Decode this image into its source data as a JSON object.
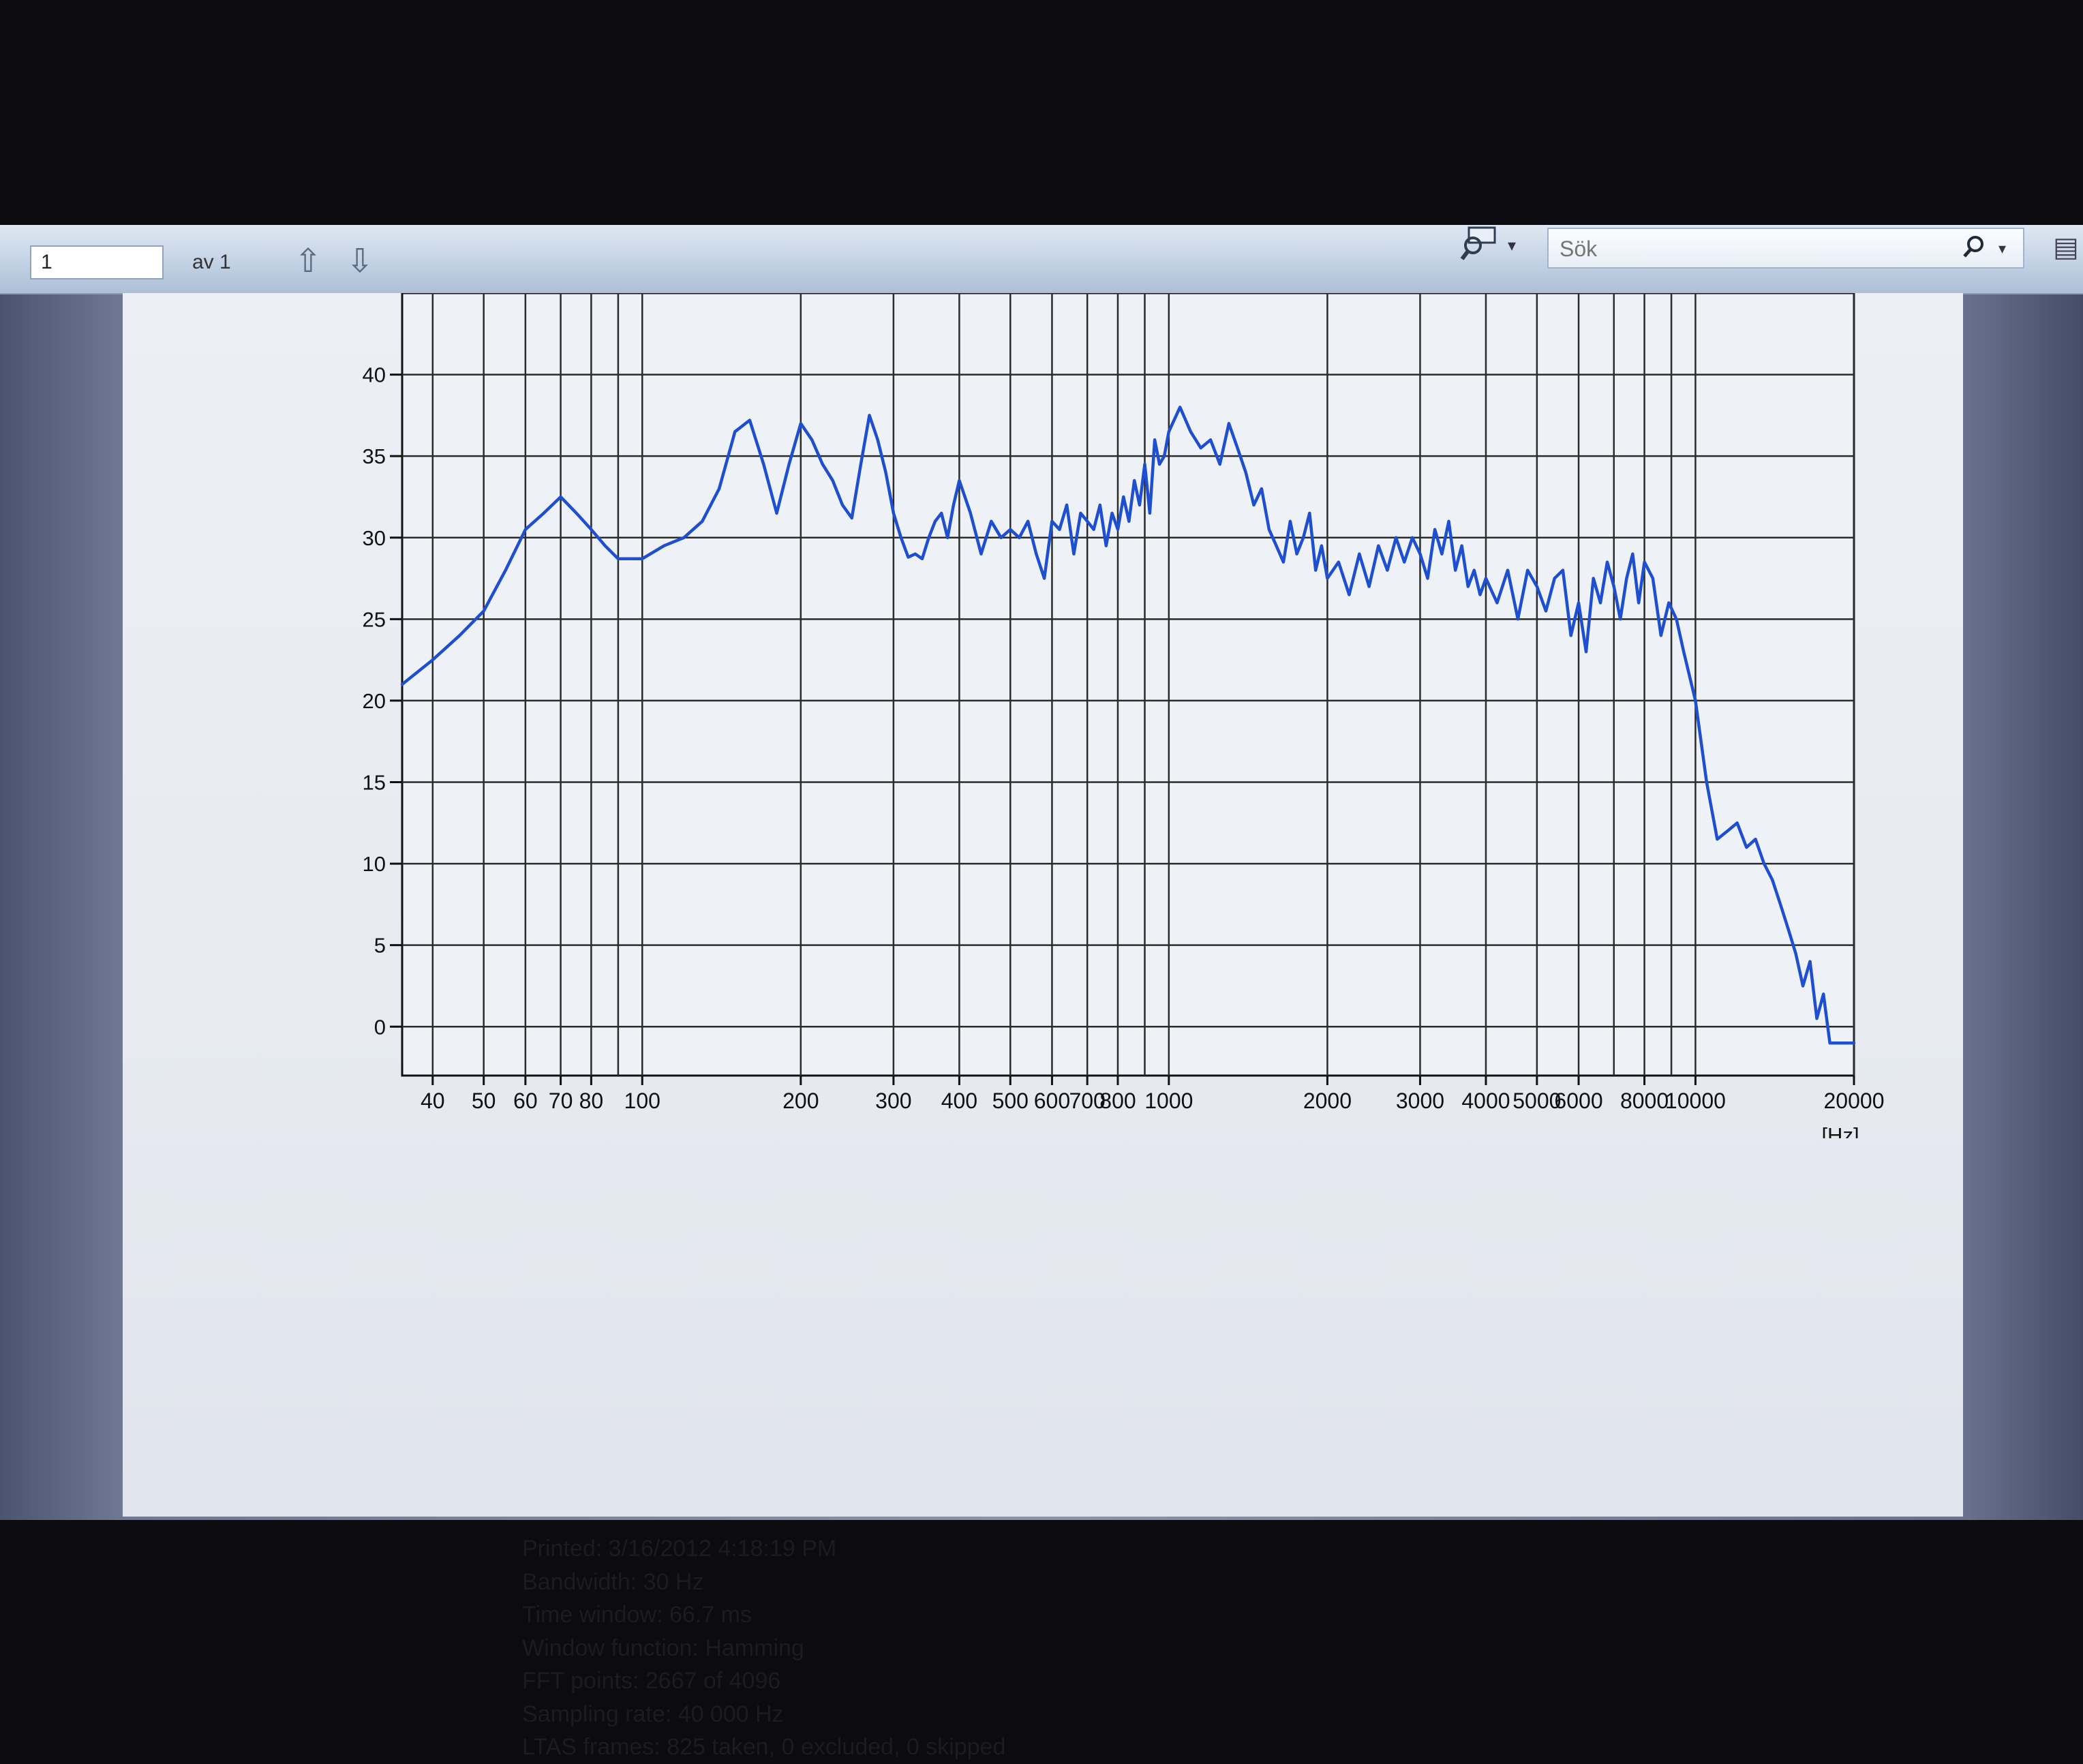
{
  "toolbar": {
    "page_number": "1",
    "page_of": "av 1",
    "up_arrow_glyph": "⇧",
    "down_arrow_glyph": "⇩",
    "search_placeholder": "Sök",
    "search_glyph": "⚲",
    "dropdown_glyph": "▾"
  },
  "info": {
    "printed": "Printed: 3/16/2012 4:18:19 PM",
    "bandwidth": "Bandwidth: 30 Hz",
    "time_window": "Time window: 66.7 ms",
    "window_function": "Window function: Hamming",
    "fft_points": "FFT points: 2667 of 4096",
    "sampling_rate": "Sampling rate: 40 000 Hz",
    "ltas_frames": "LTAS frames: 825 taken, 0 excluded, 0 skipped"
  },
  "chart_data": {
    "type": "line",
    "x_scale": "log",
    "xlim": [
      35,
      20000
    ],
    "ylim": [
      -3,
      45
    ],
    "grid": true,
    "xlabel": "[Hz]",
    "ylabel": "",
    "x_tick_labels": [
      "40",
      "50",
      "60",
      "70",
      "80",
      "100",
      "200",
      "300",
      "400",
      "500",
      "600",
      "700",
      "800",
      "1000",
      "2000",
      "3000",
      "4000",
      "5000",
      "6000",
      "8000",
      "10000",
      "20000"
    ],
    "x_ticks": [
      40,
      50,
      60,
      70,
      80,
      100,
      200,
      300,
      400,
      500,
      600,
      700,
      800,
      1000,
      2000,
      3000,
      4000,
      5000,
      6000,
      8000,
      10000,
      20000
    ],
    "x_minor_grid": [
      90,
      900,
      7000,
      9000
    ],
    "y_ticks": [
      0,
      5,
      10,
      15,
      20,
      25,
      30,
      35,
      40
    ],
    "series": [
      {
        "color": "#1d4fd0",
        "x": [
          35,
          40,
          45,
          50,
          55,
          60,
          65,
          70,
          75,
          80,
          85,
          90,
          100,
          110,
          120,
          130,
          140,
          150,
          160,
          170,
          180,
          190,
          200,
          210,
          220,
          230,
          240,
          250,
          260,
          270,
          280,
          290,
          300,
          310,
          320,
          330,
          340,
          350,
          360,
          370,
          380,
          390,
          400,
          420,
          440,
          460,
          480,
          500,
          520,
          540,
          560,
          580,
          600,
          620,
          640,
          660,
          680,
          700,
          720,
          740,
          760,
          780,
          800,
          820,
          840,
          860,
          880,
          900,
          920,
          940,
          960,
          980,
          1000,
          1050,
          1100,
          1150,
          1200,
          1250,
          1300,
          1350,
          1400,
          1450,
          1500,
          1550,
          1600,
          1650,
          1700,
          1750,
          1800,
          1850,
          1900,
          1950,
          2000,
          2100,
          2200,
          2300,
          2400,
          2500,
          2600,
          2700,
          2800,
          2900,
          3000,
          3100,
          3200,
          3300,
          3400,
          3500,
          3600,
          3700,
          3800,
          3900,
          4000,
          4200,
          4400,
          4600,
          4800,
          5000,
          5200,
          5400,
          5600,
          5800,
          6000,
          6200,
          6400,
          6600,
          6800,
          7000,
          7200,
          7400,
          7600,
          7800,
          8000,
          8300,
          8600,
          8900,
          9200,
          9500,
          10000,
          10500,
          11000,
          11500,
          12000,
          12500,
          13000,
          13500,
          14000,
          14500,
          15000,
          15500,
          16000,
          16500,
          17000,
          17500,
          18000,
          18500,
          19000,
          19500,
          20000
        ],
        "y": [
          21,
          22.5,
          24,
          25.5,
          28,
          30.5,
          31.5,
          32.5,
          31.5,
          30.5,
          29.5,
          28.7,
          28.7,
          29.5,
          30,
          31,
          33,
          36.5,
          37.2,
          34.5,
          31.5,
          34.5,
          37,
          36,
          34.5,
          33.5,
          32,
          31.2,
          34.5,
          37.5,
          36,
          34,
          31.5,
          30,
          28.8,
          29,
          28.7,
          30,
          31,
          31.5,
          30,
          32,
          33.5,
          31.5,
          29,
          31,
          30,
          30.5,
          30,
          31,
          29,
          27.5,
          31,
          30.5,
          32,
          29,
          31.5,
          31,
          30.5,
          32,
          29.5,
          31.5,
          30.5,
          32.5,
          31,
          33.5,
          32,
          34.5,
          31.5,
          36,
          34.5,
          35,
          36.5,
          38,
          36.5,
          35.5,
          36,
          34.5,
          37,
          35.5,
          34,
          32,
          33,
          30.5,
          29.5,
          28.5,
          31,
          29,
          30,
          31.5,
          28,
          29.5,
          27.5,
          28.5,
          26.5,
          29,
          27,
          29.5,
          28,
          30,
          28.5,
          30,
          29,
          27.5,
          30.5,
          29,
          31,
          28,
          29.5,
          27,
          28,
          26.5,
          27.5,
          26,
          28,
          25,
          28,
          27,
          25.5,
          27.5,
          28,
          24,
          26,
          23,
          27.5,
          26,
          28.5,
          27,
          25,
          27.5,
          29,
          26,
          28.5,
          27.5,
          24,
          26,
          25,
          23,
          20,
          15,
          11.5,
          12,
          12.5,
          11,
          11.5,
          10,
          9,
          7.5,
          6,
          4.5,
          2.5,
          4,
          0.5,
          2,
          -1,
          -1,
          -1,
          -1,
          -1
        ]
      }
    ]
  }
}
